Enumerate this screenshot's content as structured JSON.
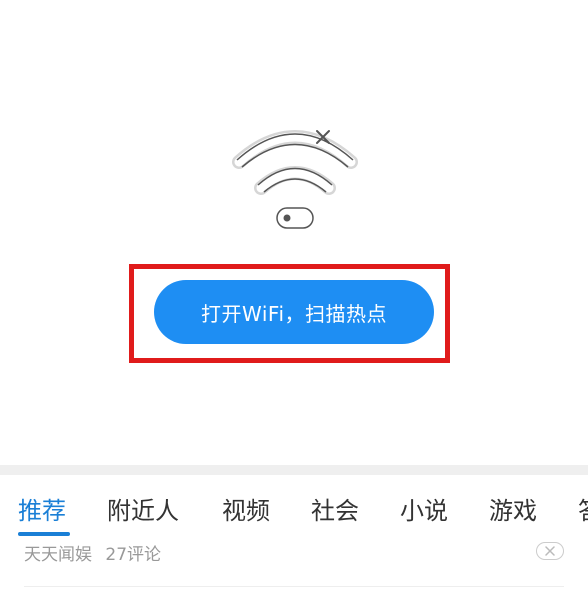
{
  "wifi_panel": {
    "illustration_icon": "wifi-off-icon",
    "open_wifi_button_label": "打开WiFi，扫描热点",
    "accent_color": "#1e8ef3",
    "highlight_color": "#e01b1b"
  },
  "tabs": [
    {
      "label": "推荐",
      "active": true
    },
    {
      "label": "附近人",
      "active": false
    },
    {
      "label": "视频",
      "active": false
    },
    {
      "label": "社会",
      "active": false
    },
    {
      "label": "小说",
      "active": false
    },
    {
      "label": "游戏",
      "active": false
    },
    {
      "label": "答",
      "active": false
    }
  ],
  "news_item": {
    "source": "天天闻娱",
    "comments": "27评论",
    "dismiss_icon": "close-icon"
  }
}
